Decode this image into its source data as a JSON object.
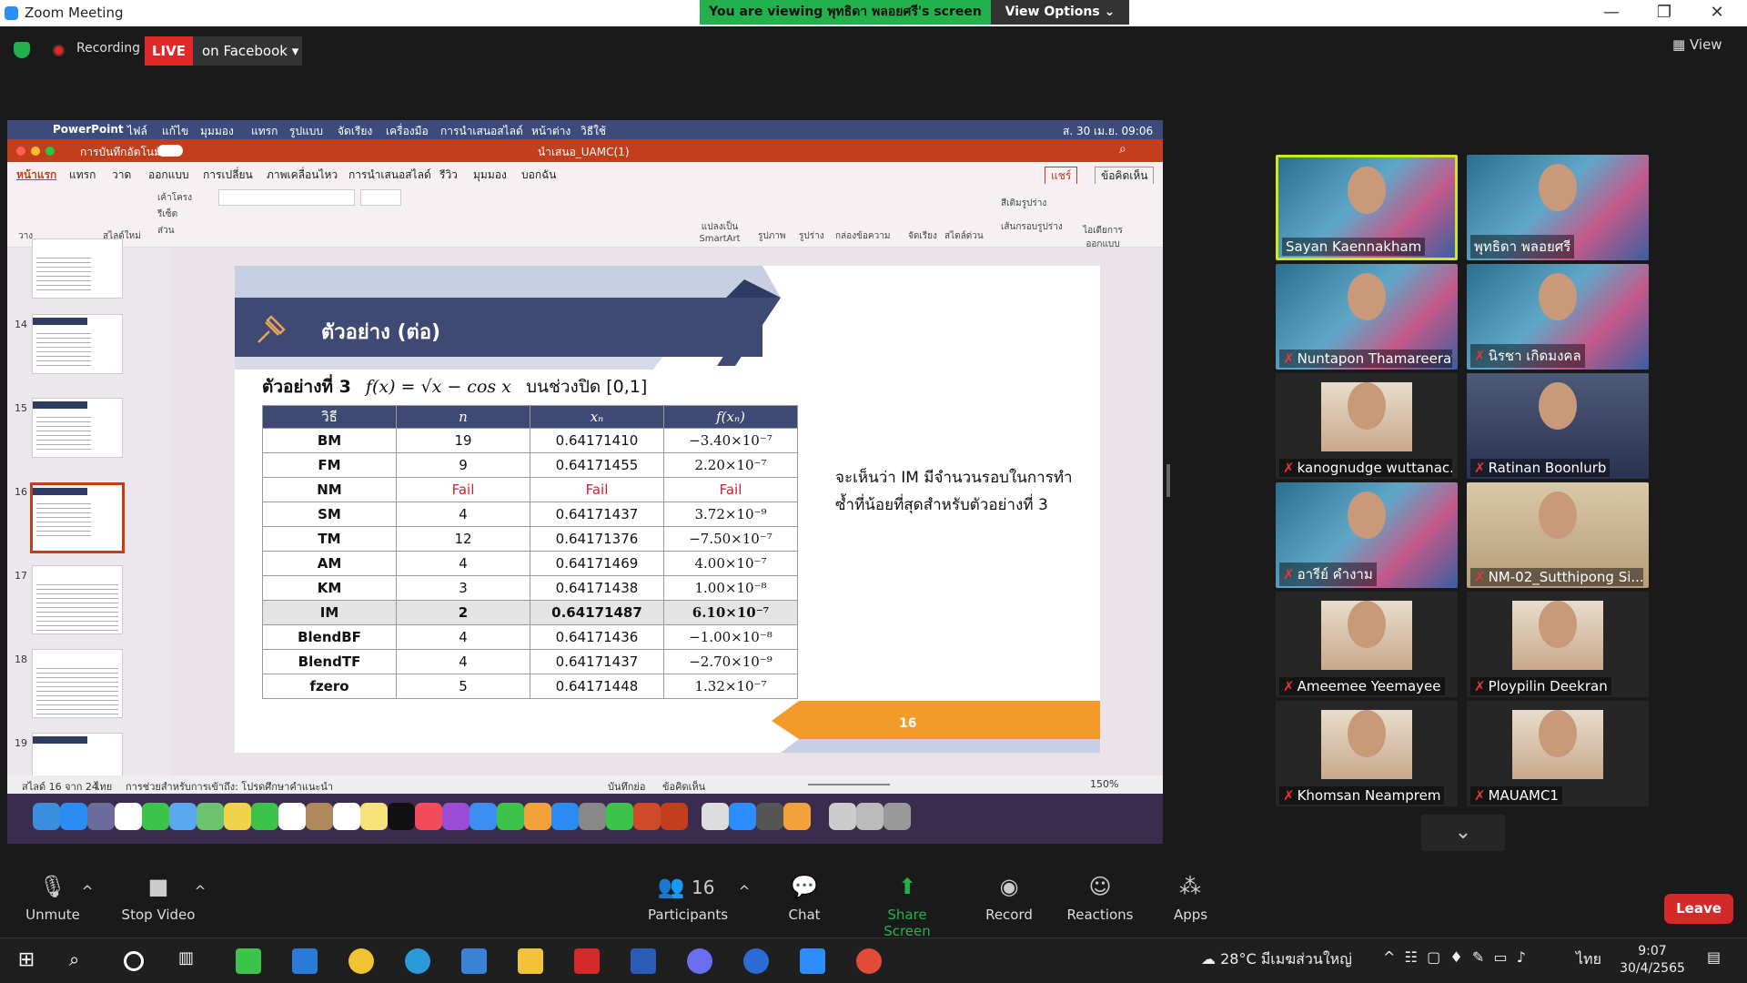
{
  "window": {
    "title": "Zoom Meeting",
    "banner": "You are viewing พุทธิดา พลอยศรี's screen",
    "view_options": "View Options"
  },
  "topbar": {
    "recording": "Recording",
    "live": "LIVE",
    "live_target": "on Facebook",
    "view": "View"
  },
  "mac_menu": {
    "app": "PowerPoint",
    "items": [
      "ไฟล์",
      "แก้ไข",
      "มุมมอง",
      "แทรก",
      "รูปแบบ",
      "จัดเรียง",
      "เครื่องมือ",
      "การนำเสนอสไลด์",
      "หน้าต่าง",
      "วิธีใช้"
    ],
    "clock": "ส. 30 เม.ย. 09:06"
  },
  "ppt": {
    "autosave": "การบันทึกอัตโนมัติ",
    "doc_title": "นำเสนอ_UAMC(1)",
    "tabs": [
      "หน้าแรก",
      "แทรก",
      "วาด",
      "ออกแบบ",
      "การเปลี่ยน",
      "ภาพเคลื่อนไหว",
      "การนำเสนอสไลด์",
      "รีวิว",
      "มุมมอง",
      "บอกฉัน"
    ],
    "share": "แชร์",
    "comments": "ข้อคิดเห็น",
    "ribbon": {
      "new_slide": "สไลด์ใหม่",
      "layout": "เค้าโครง",
      "reset": "รีเซ็ต",
      "section": "ส่วน",
      "paste": "วาง",
      "smartart": "แปลงเป็น SmartArt",
      "picture": "รูปภาพ",
      "shape": "รูปร่าง",
      "textbox": "กล่องข้อความ",
      "arrange": "จัดเรียง",
      "quick_styles": "สไตล์ด่วน",
      "fill": "สีเติมรูปร่าง",
      "outline": "เส้นกรอบรูปร่าง",
      "designer": "ไอเดียการออกแบบ"
    },
    "status": {
      "slide": "สไลด์ 16 จาก 24",
      "lang": "ไทย",
      "access": "การช่วยสำหรับการเข้าถึง: โปรดศึกษาคำแนะนำ",
      "notes": "บันทึกย่อ",
      "comments": "ข้อคิดเห็น",
      "zoom": "150%"
    },
    "thumbnails": [
      "14",
      "15",
      "16",
      "17",
      "18",
      "19"
    ]
  },
  "slide": {
    "title": "ตัวอย่าง (ต่อ)",
    "example_label": "ตัวอย่างที่ 3",
    "formula": "f(x) = √x − cos x",
    "interval": "บนช่วงปิด [0,1]",
    "headers": [
      "วิธี",
      "n",
      "xₙ",
      "f(xₙ)"
    ],
    "rows": [
      [
        "BM",
        "19",
        "0.64171410",
        "−3.40×10⁻⁷"
      ],
      [
        "FM",
        "9",
        "0.64171455",
        "2.20×10⁻⁷"
      ],
      [
        "NM",
        "Fail",
        "Fail",
        "Fail"
      ],
      [
        "SM",
        "4",
        "0.64171437",
        "3.72×10⁻⁹"
      ],
      [
        "TM",
        "12",
        "0.64171376",
        "−7.50×10⁻⁷"
      ],
      [
        "AM",
        "4",
        "0.64171469",
        "4.00×10⁻⁷"
      ],
      [
        "KM",
        "3",
        "0.64171438",
        "1.00×10⁻⁸"
      ],
      [
        "IM",
        "2",
        "0.64171487",
        "6.10×10⁻⁷"
      ],
      [
        "BlendBF",
        "4",
        "0.64171436",
        "−1.00×10⁻⁸"
      ],
      [
        "BlendTF",
        "4",
        "0.64171437",
        "−2.70×10⁻⁹"
      ],
      [
        "fzero",
        "5",
        "0.64171448",
        "1.32×10⁻⁷"
      ]
    ],
    "note": "จะเห็นว่า IM มีจำนวนรอบในการทำซ้ำที่น้อยที่สุดสำหรับตัวอย่างที่ 3",
    "page_number": "16"
  },
  "participants": [
    {
      "name": "Sayan Kaennakham",
      "muted": false,
      "active": true,
      "bg": "banner"
    },
    {
      "name": "พุทธิดา พลอยศรี",
      "muted": false,
      "active": false,
      "bg": "banner"
    },
    {
      "name": "Nuntapon Thamareerat",
      "muted": true,
      "active": false,
      "bg": "banner"
    },
    {
      "name": "นิรชา เกิดมงคล",
      "muted": true,
      "active": false,
      "bg": "banner"
    },
    {
      "name": "kanognudge wuttanac...",
      "muted": true,
      "active": false,
      "bg": "cam"
    },
    {
      "name": "Ratinan Boonlurb",
      "muted": true,
      "active": false,
      "bg": "dark"
    },
    {
      "name": "อารีย์ คำงาม",
      "muted": true,
      "active": false,
      "bg": "banner"
    },
    {
      "name": "NM-02_Sutthipong Si...",
      "muted": true,
      "active": false,
      "bg": "plain"
    },
    {
      "name": "Ameemee Yeemayee",
      "muted": true,
      "active": false,
      "bg": "cam"
    },
    {
      "name": "Ploypilin Deekran",
      "muted": true,
      "active": false,
      "bg": "cam"
    },
    {
      "name": "Khomsan Neamprem",
      "muted": true,
      "active": false,
      "bg": "cam"
    },
    {
      "name": "MAUAMC1",
      "muted": true,
      "active": false,
      "bg": "cam"
    }
  ],
  "controls": {
    "unmute": "Unmute",
    "stop_video": "Stop Video",
    "participants": "Participants",
    "participants_count": "16",
    "chat": "Chat",
    "share": "Share Screen",
    "record": "Record",
    "reactions": "Reactions",
    "apps": "Apps",
    "leave": "Leave"
  },
  "taskbar": {
    "weather": "28°C มีเมฆส่วนใหญ่",
    "lang": "ไทย",
    "time": "9:07",
    "date": "30/4/2565"
  },
  "colors": {
    "accent_live": "#e02828",
    "banner_green": "#23b14d",
    "slide_navy": "#3e4a74",
    "slide_orange": "#f29b2a",
    "ppt_red": "#c43e1c"
  }
}
